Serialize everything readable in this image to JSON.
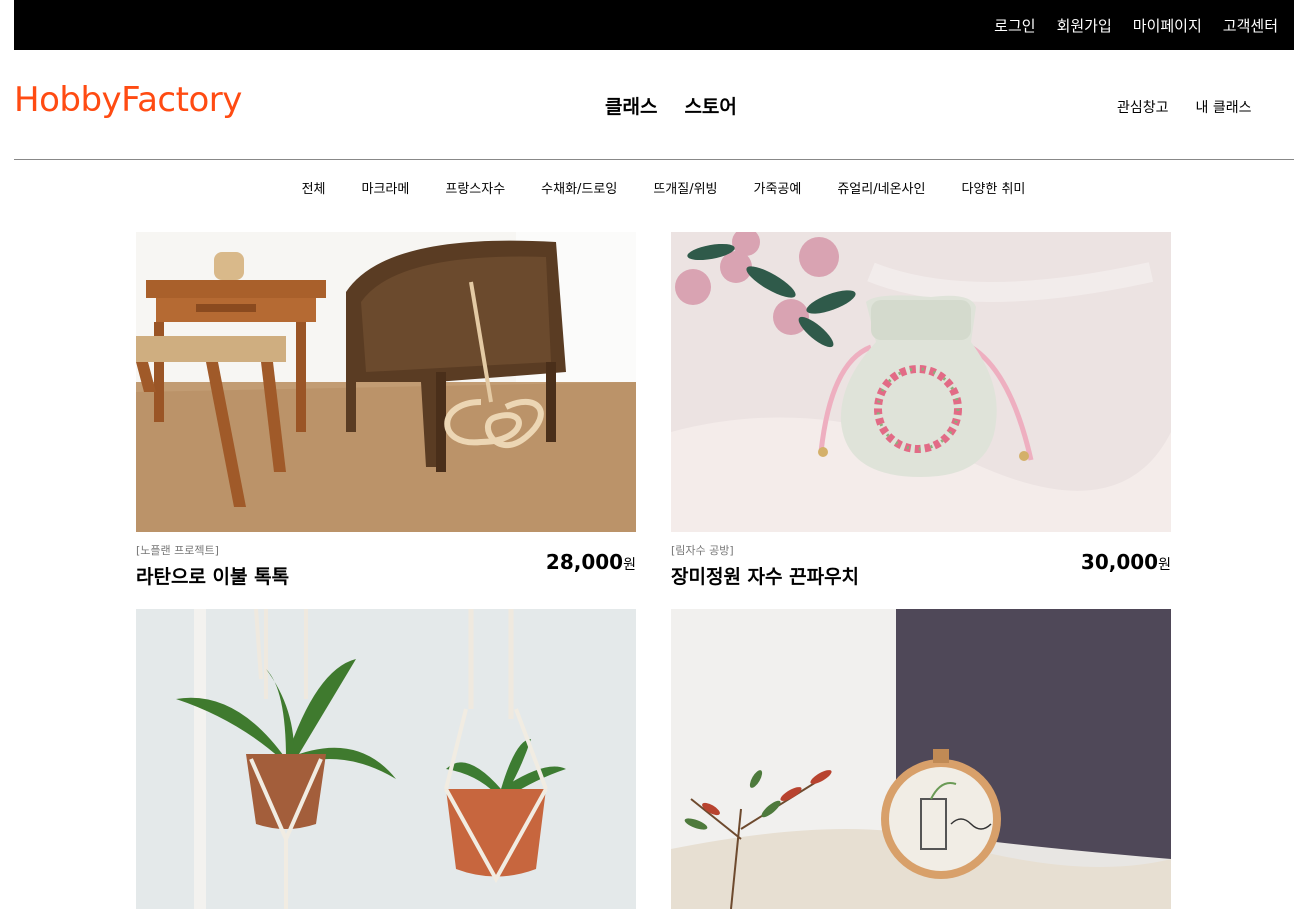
{
  "topbar": {
    "links": [
      "로그인",
      "회원가입",
      "마이페이지",
      "고객센터"
    ]
  },
  "header": {
    "logo": "HobbyFactory",
    "main_nav": [
      "클래스",
      "스토어"
    ],
    "user_nav": [
      "관심창고",
      "내 클래스"
    ]
  },
  "categories": [
    "전체",
    "마크라메",
    "프랑스자수",
    "수채화/드로잉",
    "뜨개질/위빙",
    "가죽공예",
    "쥬얼리/네온사인",
    "다양한 취미"
  ],
  "products": [
    {
      "shop": "[노플랜 프로젝트]",
      "title": "라탄으로 이불 톡톡",
      "price": "28,000",
      "currency": "원"
    },
    {
      "shop": "[림자수 공방]",
      "title": "장미정원 자수 끈파우치",
      "price": "30,000",
      "currency": "원"
    }
  ],
  "colors": {
    "brand": "#ff4b12",
    "topbar": "#000000"
  }
}
